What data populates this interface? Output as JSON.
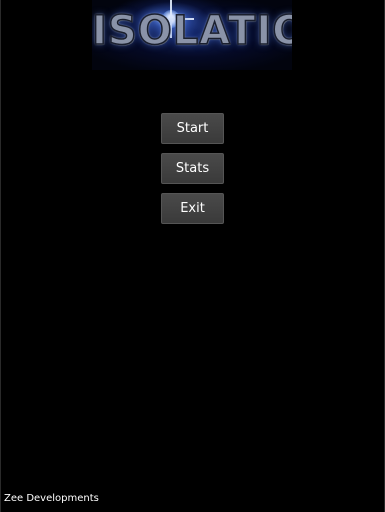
{
  "logo": {
    "text": "ISOLATION"
  },
  "menu": {
    "start_label": "Start",
    "stats_label": "Stats",
    "exit_label": "Exit"
  },
  "footer": {
    "developer": "Zee Developments"
  },
  "colors": {
    "background": "#000000",
    "button": "#444444",
    "button_text": "#ffffff",
    "logo_glow": "#3a64d2"
  }
}
